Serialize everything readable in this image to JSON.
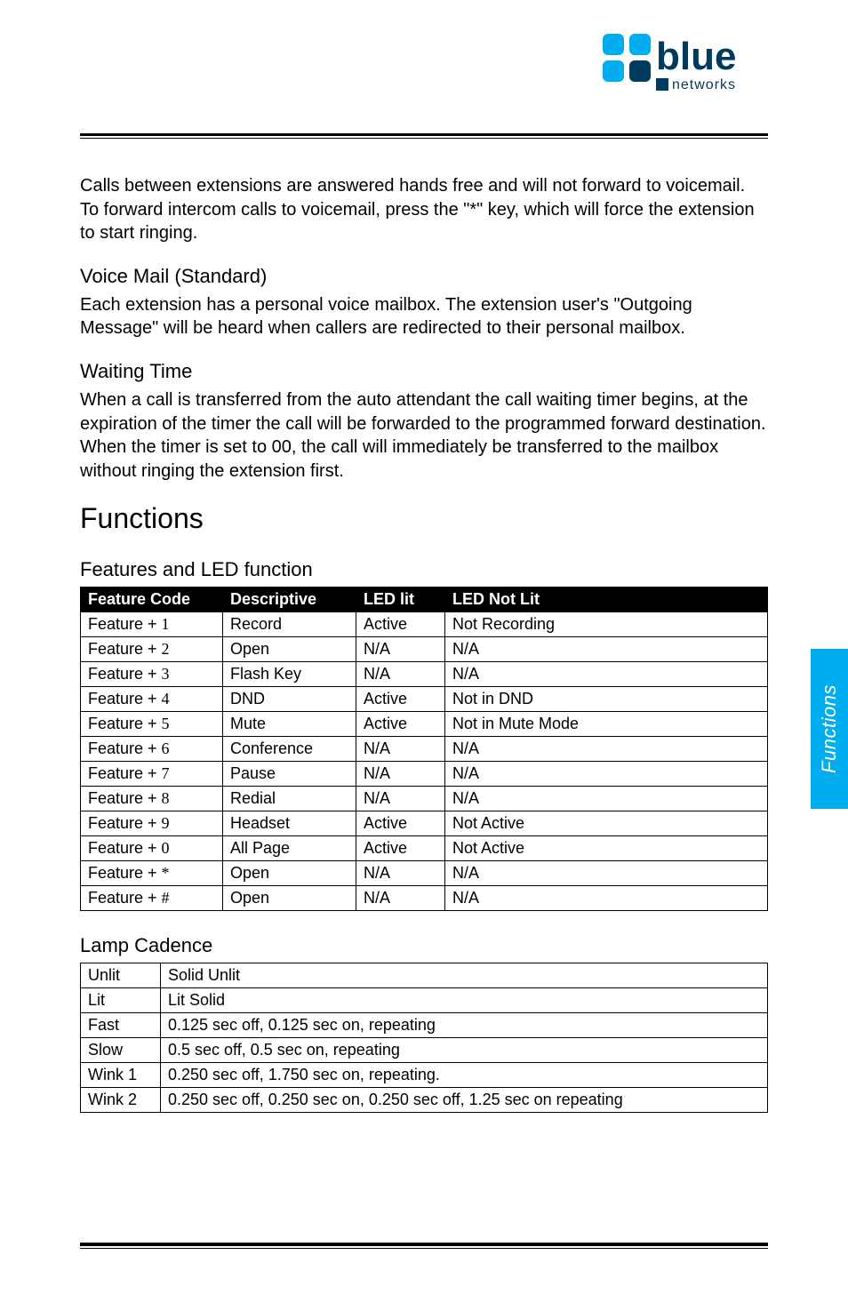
{
  "logo": {
    "text": "blue",
    "sub": "networks"
  },
  "side_tab": "Functions",
  "intro_para": "Calls between extensions are answered hands free and will not forward to voicemail.  To forward intercom calls to voicemail, press the \"*\" key, which will force the extension to start ringing.",
  "voice_mail": {
    "heading": "Voice Mail (Standard)",
    "body": "Each extension has a personal voice mailbox. The extension user's \"Outgoing Message\" will be heard when callers are redirected to their personal mailbox."
  },
  "waiting_time": {
    "heading": "Waiting Time",
    "body": "When a call is transferred from the auto attendant the call waiting timer begins, at the expiration of the timer the call will be forwarded to the programmed forward destination. When the timer is set to 00, the call will immediately be transferred to the mailbox without ringing the extension first."
  },
  "functions_heading": "Functions",
  "features_led": {
    "heading": "Features and LED function",
    "columns": [
      "Feature Code",
      "Descriptive",
      "LED lit",
      "LED Not Lit"
    ],
    "rows": [
      {
        "code_prefix": "Feature + ",
        "code_suffix": "1",
        "descriptive": "Record",
        "led_lit": "Active",
        "led_not_lit": "Not Recording"
      },
      {
        "code_prefix": "Feature + ",
        "code_suffix": "2",
        "descriptive": "Open",
        "led_lit": "N/A",
        "led_not_lit": "N/A"
      },
      {
        "code_prefix": "Feature + ",
        "code_suffix": "3",
        "descriptive": "Flash Key",
        "led_lit": "N/A",
        "led_not_lit": "N/A"
      },
      {
        "code_prefix": "Feature + ",
        "code_suffix": "4",
        "descriptive": "DND",
        "led_lit": "Active",
        "led_not_lit": "Not in DND"
      },
      {
        "code_prefix": "Feature + ",
        "code_suffix": "5",
        "descriptive": "Mute",
        "led_lit": "Active",
        "led_not_lit": "Not in Mute Mode"
      },
      {
        "code_prefix": "Feature + ",
        "code_suffix": "6",
        "descriptive": "Conference",
        "led_lit": "N/A",
        "led_not_lit": "N/A"
      },
      {
        "code_prefix": "Feature + ",
        "code_suffix": "7",
        "descriptive": "Pause",
        "led_lit": "N/A",
        "led_not_lit": "N/A"
      },
      {
        "code_prefix": "Feature + ",
        "code_suffix": "8",
        "descriptive": "Redial",
        "led_lit": "N/A",
        "led_not_lit": "N/A"
      },
      {
        "code_prefix": "Feature + ",
        "code_suffix": "9",
        "descriptive": "Headset",
        "led_lit": "Active",
        "led_not_lit": "Not Active"
      },
      {
        "code_prefix": "Feature + ",
        "code_suffix": "0",
        "descriptive": "All Page",
        "led_lit": "Active",
        "led_not_lit": "Not Active"
      },
      {
        "code_prefix": "Feature + ",
        "code_suffix": "*",
        "descriptive": "Open",
        "led_lit": "N/A",
        "led_not_lit": "N/A"
      },
      {
        "code_prefix": "Feature + ",
        "code_suffix": "#",
        "descriptive": "Open",
        "led_lit": "N/A",
        "led_not_lit": "N/A"
      }
    ]
  },
  "lamp_cadence": {
    "heading": "Lamp Cadence",
    "rows": [
      {
        "name": "Unlit",
        "desc": "Solid Unlit"
      },
      {
        "name": "Lit",
        "desc": "Lit Solid"
      },
      {
        "name": "Fast",
        "desc": "0.125 sec off, 0.125 sec on, repeating"
      },
      {
        "name": "Slow",
        "desc": "0.5 sec off, 0.5 sec on, repeating"
      },
      {
        "name": "Wink 1",
        "desc": "0.250 sec off, 1.750 sec on, repeating."
      },
      {
        "name": "Wink 2",
        "desc": "0.250 sec off, 0.250 sec on, 0.250 sec off, 1.25 sec on repeating"
      }
    ]
  }
}
